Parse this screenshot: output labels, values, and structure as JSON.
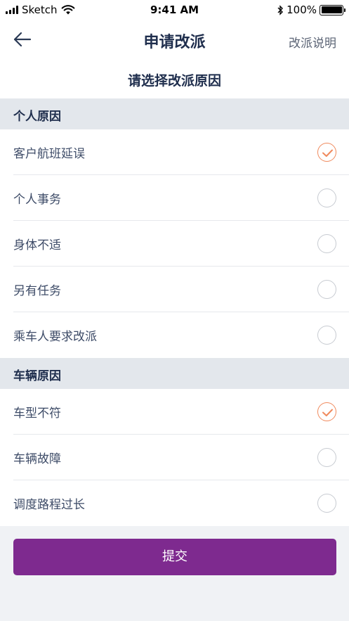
{
  "status_bar": {
    "carrier": "Sketch",
    "time": "9:41 AM",
    "battery": "100%"
  },
  "navbar": {
    "title": "申请改派",
    "right_link": "改派说明",
    "back_icon": "arrow-left-icon"
  },
  "subtitle": "请选择改派原因",
  "sections": [
    {
      "header": "个人原因",
      "items": [
        {
          "label": "客户航班延误",
          "checked": true
        },
        {
          "label": "个人事务",
          "checked": false
        },
        {
          "label": "身体不适",
          "checked": false
        },
        {
          "label": "另有任务",
          "checked": false
        },
        {
          "label": "乘车人要求改派",
          "checked": false
        }
      ]
    },
    {
      "header": "车辆原因",
      "items": [
        {
          "label": "车型不符",
          "checked": true
        },
        {
          "label": "车辆故障",
          "checked": false
        },
        {
          "label": "调度路程过长",
          "checked": false
        }
      ]
    }
  ],
  "submit_label": "提交",
  "colors": {
    "accent": "#7e2a8f",
    "check": "#f08a5d",
    "section_bg": "#e3e7ec",
    "title": "#1f2e4d"
  }
}
